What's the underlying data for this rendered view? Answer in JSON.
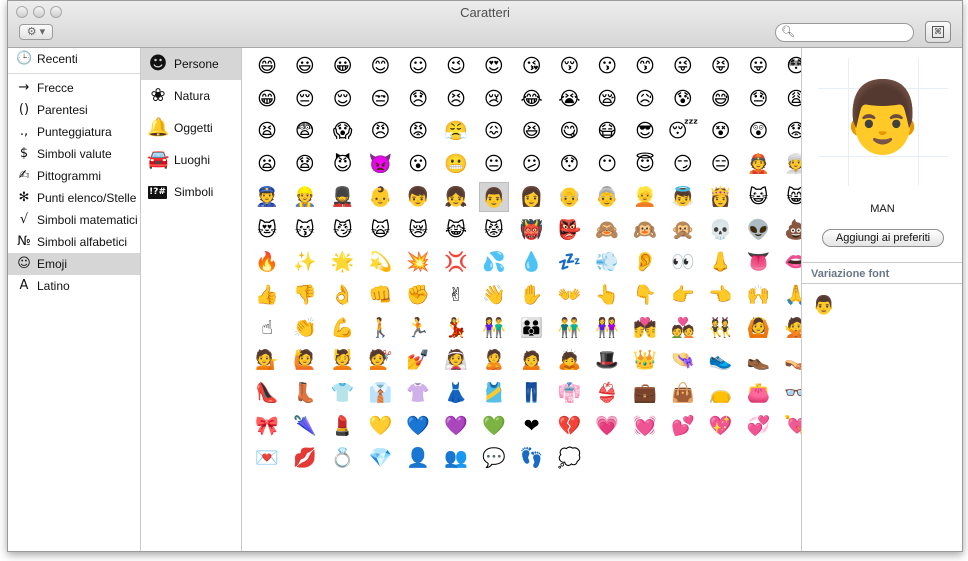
{
  "window": {
    "title": "Caratteri"
  },
  "toolbar": {
    "gear_label": "⚙ ▾",
    "search_placeholder": "",
    "search_value": ""
  },
  "sidebar": {
    "items": [
      {
        "icon": "🕒",
        "icon_name": "clock-icon",
        "label": "Recenti"
      },
      {
        "icon": "→",
        "icon_name": "arrow-icon",
        "label": "Frecce"
      },
      {
        "icon": "()",
        "icon_name": "parentheses-icon",
        "label": "Parentesi"
      },
      {
        "icon": ".,",
        "icon_name": "punctuation-icon",
        "label": "Punteggiatura"
      },
      {
        "icon": "$",
        "icon_name": "dollar-icon",
        "label": "Simboli valute"
      },
      {
        "icon": "✍",
        "icon_name": "writing-hand-icon",
        "label": "Pittogrammi"
      },
      {
        "icon": "✻",
        "icon_name": "asterisk-icon",
        "label": "Punti elenco/Stelle"
      },
      {
        "icon": "√",
        "icon_name": "square-root-icon",
        "label": "Simboli matematici"
      },
      {
        "icon": "№",
        "icon_name": "numero-icon",
        "label": "Simboli alfabetici"
      },
      {
        "icon": "☺",
        "icon_name": "smiley-icon",
        "label": "Emoji"
      },
      {
        "icon": "A",
        "icon_name": "letter-a-icon",
        "label": "Latino"
      }
    ],
    "selected": "Emoji"
  },
  "categories": {
    "items": [
      {
        "icon": "☻",
        "icon_name": "face-icon",
        "label": "Persone"
      },
      {
        "icon": "❀",
        "icon_name": "flower-icon",
        "label": "Natura"
      },
      {
        "icon": "🔔",
        "icon_name": "bell-icon",
        "label": "Oggetti"
      },
      {
        "icon": "🚘",
        "icon_name": "car-icon",
        "label": "Luoghi"
      },
      {
        "icon": "!?#",
        "icon_name": "symbols-icon",
        "label": "Simboli"
      }
    ],
    "selected": "Persone"
  },
  "grid": {
    "columns": 15,
    "selected_index": 66,
    "emojis": [
      "😄",
      "😃",
      "😀",
      "😊",
      "☺",
      "😉",
      "😍",
      "😘",
      "😚",
      "😗",
      "😙",
      "😜",
      "😝",
      "😛",
      "😳",
      "😁",
      "😔",
      "😌",
      "😒",
      "😞",
      "😣",
      "😢",
      "😂",
      "😭",
      "😪",
      "😥",
      "😰",
      "😅",
      "😓",
      "😩",
      "😫",
      "😨",
      "😱",
      "😠",
      "😡",
      "😤",
      "😖",
      "😆",
      "😋",
      "😷",
      "😎",
      "😴",
      "😵",
      "😲",
      "😟",
      "😦",
      "😧",
      "😈",
      "👿",
      "😮",
      "😬",
      "😐",
      "😕",
      "😯",
      "😶",
      "😇",
      "😏",
      "😑",
      "👲",
      "👳",
      "👮",
      "👷",
      "💂",
      "👶",
      "👦",
      "👧",
      "👨",
      "👩",
      "👴",
      "👵",
      "👱",
      "👼",
      "👸",
      "😺",
      "😸",
      "😻",
      "😽",
      "😼",
      "🙀",
      "😿",
      "😹",
      "😾",
      "👹",
      "👺",
      "🙈",
      "🙉",
      "🙊",
      "💀",
      "👽",
      "💩",
      "🔥",
      "✨",
      "🌟",
      "💫",
      "💥",
      "💢",
      "💦",
      "💧",
      "💤",
      "💨",
      "👂",
      "👀",
      "👃",
      "👅",
      "👄",
      "👍",
      "👎",
      "👌",
      "👊",
      "✊",
      "✌",
      "👋",
      "✋",
      "👐",
      "👆",
      "👇",
      "👉",
      "👈",
      "🙌",
      "🙏",
      "☝",
      "👏",
      "💪",
      "🚶",
      "🏃",
      "💃",
      "👫",
      "👪",
      "👬",
      "👭",
      "💏",
      "💑",
      "👯",
      "🙆",
      "🙅",
      "💁",
      "🙋",
      "💆",
      "💇",
      "💅",
      "👰",
      "🙎",
      "🙍",
      "🙇",
      "🎩",
      "👑",
      "👒",
      "👟",
      "👞",
      "👡",
      "👠",
      "👢",
      "👕",
      "👔",
      "👚",
      "👗",
      "🎽",
      "👖",
      "👘",
      "👙",
      "💼",
      "👜",
      "👝",
      "👛",
      "👓",
      "🎀",
      "🌂",
      "💄",
      "💛",
      "💙",
      "💜",
      "💚",
      "❤",
      "💔",
      "💗",
      "💓",
      "💕",
      "💖",
      "💞",
      "💘",
      "💌",
      "💋",
      "💍",
      "💎",
      "👤",
      "👥",
      "💬",
      "👣",
      "💭"
    ]
  },
  "detail": {
    "glyph": "👨",
    "name": "MAN",
    "add_favorite_label": "Aggiungi ai preferiti",
    "variation_title": "Variazione font",
    "variations": [
      "👨"
    ]
  }
}
